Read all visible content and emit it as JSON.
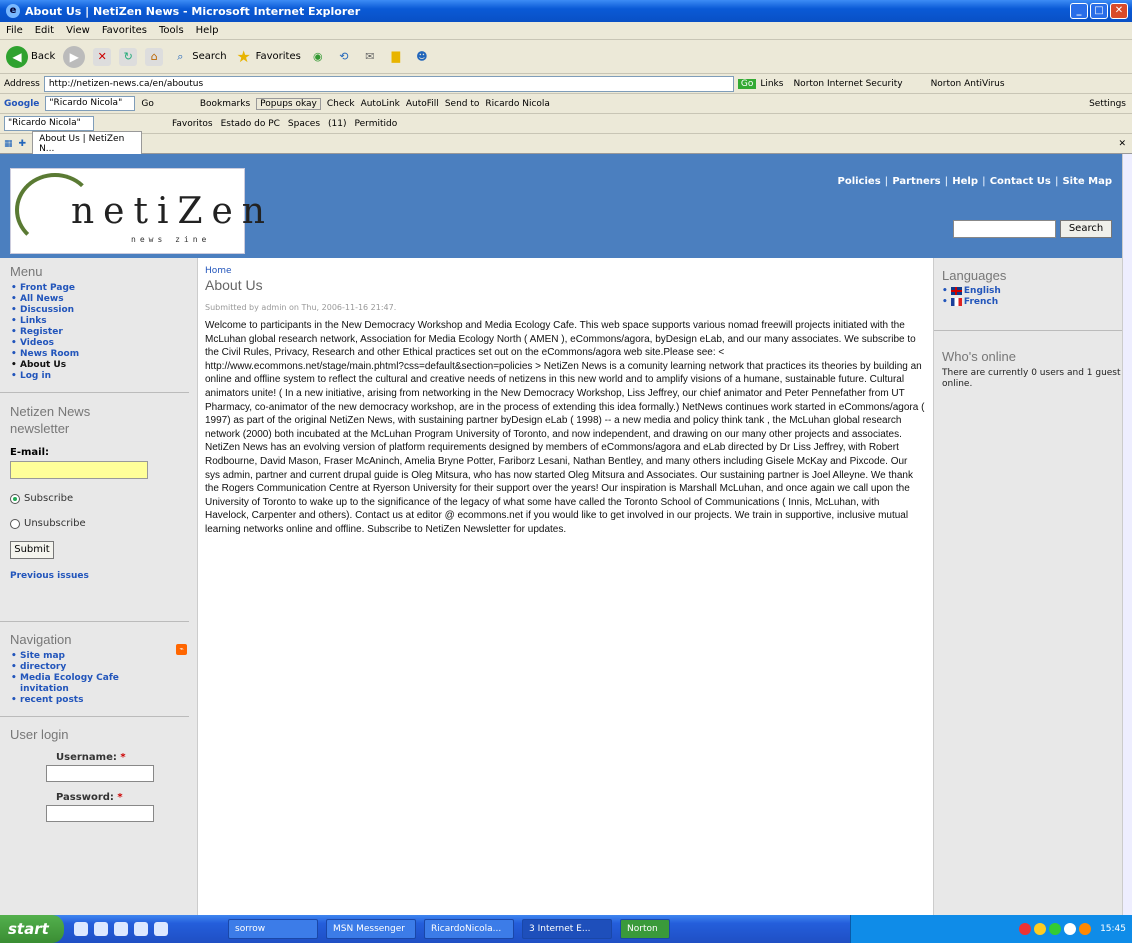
{
  "window": {
    "title": "About Us | NetiZen News - Microsoft Internet Explorer"
  },
  "menubar": [
    "File",
    "Edit",
    "View",
    "Favorites",
    "Tools",
    "Help"
  ],
  "toolbar": {
    "back": "Back",
    "search": "Search",
    "favorites": "Favorites"
  },
  "address": {
    "label": "Address",
    "url": "http://netizen-news.ca/en/aboutus",
    "go": "Go",
    "links": "Links",
    "norton_security": "Norton Internet Security",
    "norton_antivirus": "Norton AntiVirus"
  },
  "googlebar": {
    "brand": "Google",
    "query": "\"Ricardo Nicola\"",
    "go": "Go",
    "bookmarks": "Bookmarks",
    "popups": "Popups okay",
    "check": "Check",
    "autolink": "AutoLink",
    "autofill": "AutoFill",
    "sendto": "Send to",
    "user": "Ricardo Nicola",
    "settings": "Settings"
  },
  "linksbar": {
    "query": "\"Ricardo Nicola\"",
    "favoritos": "Favoritos",
    "estado": "Estado do PC",
    "spaces": "Spaces",
    "count": "(11)",
    "permitido": "Permitido"
  },
  "tab": {
    "label": "About Us | NetiZen N..."
  },
  "site": {
    "logo": {
      "word": "netiZen",
      "sub": "news  zine"
    },
    "toplinks": [
      "Policies",
      "Partners",
      "Help",
      "Contact Us",
      "Site Map"
    ],
    "search_button": "Search"
  },
  "left": {
    "menu_title": "Menu",
    "menu": [
      "Front Page",
      "All News",
      "Discussion",
      "Links",
      "Register",
      "Videos",
      "News Room",
      "About Us",
      "Log in"
    ],
    "newsletter_title": "Netizen News newsletter",
    "email_label": "E-mail:",
    "subscribe": "Subscribe",
    "unsubscribe": "Unsubscribe",
    "submit": "Submit",
    "previous": "Previous issues",
    "nav_title": "Navigation",
    "nav": [
      "Site map",
      "directory",
      "Media Ecology Cafe invitation",
      "recent posts"
    ],
    "login_title": "User login",
    "username": "Username:",
    "password": "Password:"
  },
  "main": {
    "crumb": "Home",
    "title": "About Us",
    "meta": "Submitted by admin on Thu, 2006-11-16 21:47.",
    "p1": "Welcome to participants in the New Democracy Workshop and Media Ecology Cafe. This web space supports various nomad freewill projects initiated with the McLuhan global research network, Association for Media Ecology North ( AMEN ), eCommons/agora, byDesign eLab, and our many associates.  We subscribe to the Civil Rules, Privacy, Research and other Ethical practices set out on the eCommons/agora web site.Please see: < http://www.ecommons.net/stage/main.phtml?css=default&section=policies > NetiZen News is a comunity learning network that practices its theories by building an online and offline system to reflect the cultural and creative needs of netizens in this new world and to amplify visions of a humane, sustainable future. Cultural animators unite! ( In a new initiative, arising from networking in the New Democracy Workshop, Liss Jeffrey, our chief animator and Peter Pennefather from UT Pharmacy, co-animator of the new democracy workshop, are in the process of extending this idea formally.) NetNews continues work started in eCommons/agora ( 1997) as part of the original NetiZen News, with sustaining partner byDesign eLab ( 1998) -- a new media and policy think tank , the McLuhan global research network (2000) both incubated at the McLuhan Program University of Toronto, and now independent, and drawing on our many other projects and associates. NetiZen News has an evolving version of platform requirements designed by members of eCommons/agora and eLab directed by Dr Liss Jeffrey, with Robert Rodbourne, David Mason, Fraser McAninch, Amelia Bryne Potter, Fariborz Lesani, Nathan Bentley, and many others including Gisele McKay and Pixcode. Our sys admin, partner and current drupal guide is Oleg Mitsura, who has now started Oleg Mitsura and Associates. Our sustaining partner is Joel Alleyne. We thank the Rogers Communication Centre at Ryerson University for their support over the years! Our inspiration is Marshall McLuhan, and once again we call upon the University of Toronto to wake up to the significance of the legacy of what some have called the Toronto School of Communications ( Innis, McLuhan, with Havelock, Carpenter and others). Contact us at editor @ ecommons.net if you would like to get involved in our projects. We train in supportive, inclusive mutual learning networks online and offline. Subscribe to NetiZen Newsletter for updates."
  },
  "right": {
    "lang_title": "Languages",
    "langs": [
      "English",
      "French"
    ],
    "who_title": "Who's online",
    "who_text": "There are currently 0 users and 1 guest online."
  },
  "taskbar": {
    "start": "start",
    "tasks": [
      "sorrow",
      "MSN Messenger",
      "RicardoNicola...",
      "3 Internet E...",
      "Norton"
    ],
    "clock": "15:45"
  }
}
